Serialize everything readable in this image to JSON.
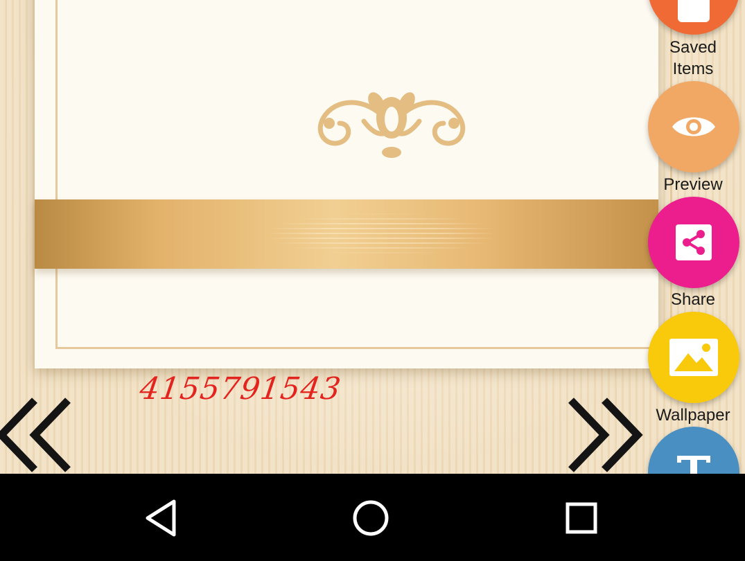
{
  "card": {
    "phone_number": "4155791543"
  },
  "navigation": {
    "prev_icon": "double-chevron-left-icon",
    "next_icon": "double-chevron-right-icon"
  },
  "toolbar": {
    "items": [
      {
        "label": "Saved\nItems",
        "icon": "save-icon",
        "color": "#f06a35"
      },
      {
        "label": "Preview",
        "icon": "eye-icon",
        "color": "#f2a865"
      },
      {
        "label": "Share",
        "icon": "share-icon",
        "color": "#ec1e8d"
      },
      {
        "label": "Wallpaper",
        "icon": "image-icon",
        "color": "#f9c90c"
      },
      {
        "label": "",
        "icon": "text-icon",
        "color": "#4a8fc2"
      }
    ]
  },
  "system_nav": {
    "back_icon": "back-triangle-icon",
    "home_icon": "home-circle-icon",
    "recents_icon": "recents-square-icon"
  }
}
